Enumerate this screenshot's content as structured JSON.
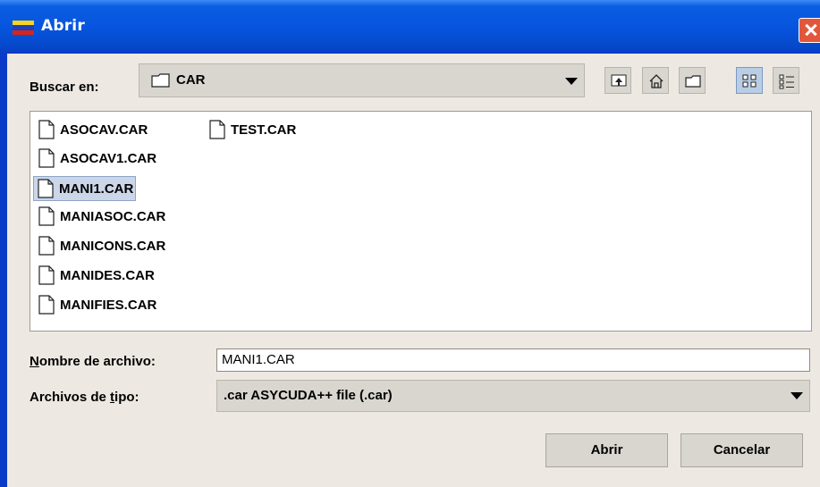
{
  "window": {
    "title": "Abrir",
    "flag_colors": [
      "#f7d51c",
      "#1d3fb8",
      "#d8241c"
    ]
  },
  "lookin": {
    "label": "Buscar en:",
    "value": "CAR"
  },
  "toolbar": {
    "buttons": [
      "up-folder-icon",
      "home-icon",
      "new-folder-icon",
      "list-view-icon",
      "details-view-icon"
    ]
  },
  "files": [
    "ASOCAV.CAR",
    "ASOCAV1.CAR",
    "MANI1.CAR",
    "MANIASOC.CAR",
    "MANICONS.CAR",
    "MANIDES.CAR",
    "MANIFIES.CAR",
    "TEST.CAR"
  ],
  "selected_file": "MANI1.CAR",
  "filename": {
    "label_prefix": "",
    "label_underline": "N",
    "label_rest": "ombre de archivo:",
    "value": "MANI1.CAR"
  },
  "filetype": {
    "label_prefix": "Archivos de ",
    "label_underline": "t",
    "label_rest": "ipo:",
    "value": ".car ASYCUDA++ file (.car)"
  },
  "buttons": {
    "open": "Abrir",
    "cancel": "Cancelar"
  }
}
